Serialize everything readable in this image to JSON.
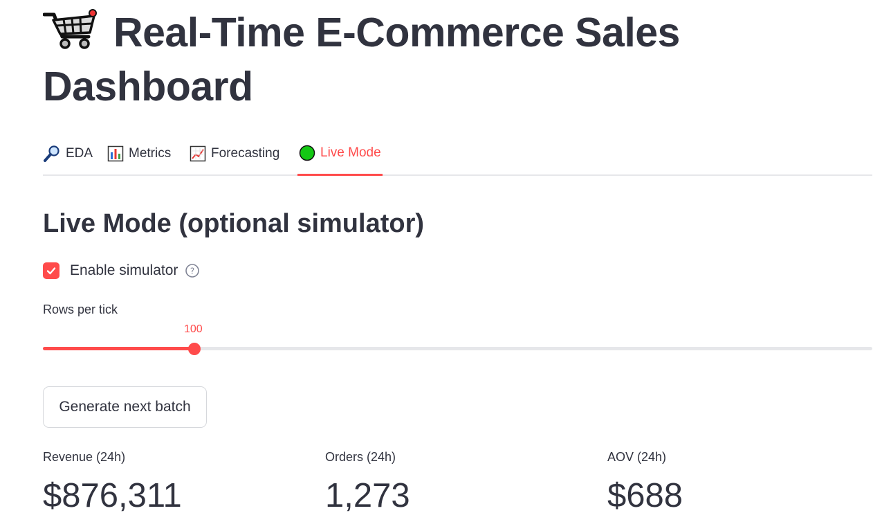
{
  "header": {
    "title": "Real-Time E-Commerce Sales Dashboard",
    "icon": "shopping-cart-icon"
  },
  "tabs": [
    {
      "label": "EDA",
      "icon": "magnifier-icon",
      "active": false
    },
    {
      "label": "Metrics",
      "icon": "bar-chart-icon",
      "active": false
    },
    {
      "label": "Forecasting",
      "icon": "trend-chart-icon",
      "active": false
    },
    {
      "label": "Live Mode",
      "icon": "green-circle-icon",
      "active": true
    }
  ],
  "live": {
    "heading": "Live Mode (optional simulator)",
    "simulator": {
      "label": "Enable simulator",
      "checked": true
    },
    "slider": {
      "label": "Rows per tick",
      "value": "100",
      "fill_fraction": 0.183
    },
    "button_label": "Generate next batch"
  },
  "metrics": [
    {
      "label": "Revenue (24h)",
      "value": "$876,311"
    },
    {
      "label": "Orders (24h)",
      "value": "1,273"
    },
    {
      "label": "AOV (24h)",
      "value": "$688"
    }
  ],
  "colors": {
    "accent": "#ff4b4b",
    "text": "#31333f",
    "track": "#e6e7ea",
    "live_dot": "#14c814"
  }
}
